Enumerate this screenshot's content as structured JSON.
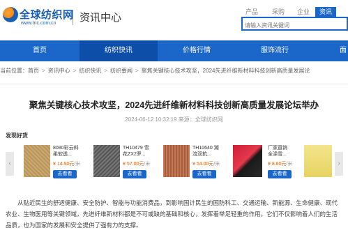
{
  "header": {
    "logo_name": "全球纺织网",
    "logo_url": "www.tnc.com.cn",
    "section_title": "资讯中心"
  },
  "search": {
    "tabs": [
      "产品",
      "采购",
      "企业",
      "资讯"
    ],
    "active_tab": "资讯",
    "placeholder": "请输入资讯关键词"
  },
  "nav": {
    "items": [
      "首页",
      "纺织快讯",
      "价格行情",
      "服饰流行",
      "面"
    ],
    "active": "纺织快讯"
  },
  "breadcrumb": {
    "items": [
      "当前位置：首页",
      "资讯中心",
      "纺织快讯",
      "纺织要闻",
      "聚焦关键核心技术攻坚，2024先进纤维新材料科技创新高质量发展论"
    ]
  },
  "article": {
    "title": "聚焦关键核心技术攻坚，2024先进纤维新材料科技创新高质量发展论坛举办",
    "meta": "2024-06-12 10:32:19 来源：全球纺织网"
  },
  "products": {
    "label": "发现好货",
    "button_label": "去看看",
    "items": [
      {
        "name": "8080彩云斜柔软透...",
        "price": "¥ 14.50元",
        "unit": "/米",
        "image_icon": "fabric-swatch-icon"
      },
      {
        "name": "TH10479 雪花ZX2罗...",
        "price": "¥ 57.00元",
        "unit": "/米",
        "image_icon": "fabric-swatch-icon"
      },
      {
        "name": "TH10640 潮流双抗...",
        "price": "¥ 54.00元",
        "unit": "/米",
        "image_icon": "fabric-swatch-icon"
      },
      {
        "name": "厂家直销 全涤雪...",
        "price": "¥ 8.60元",
        "unit": "/米",
        "image_icon": "fabric-swatch-icon"
      },
      {
        "name": "",
        "price": "",
        "unit": "",
        "image_icon": "fabric-swatch-icon"
      }
    ]
  },
  "body": {
    "paragraph": "从贴近民生的舒适健康、安全防护、智能与功能消费品，到影响国计民生的国防科工、交通运输、新能源、生命健康、现代农业、生物医用等关键领域，先进纤维新材料都是不可或缺的基础和核心，发挥着举足轻重的作用。它们不仅影响着人们的生活品质，也为国家的发展和安全提供了强有力的支撑。"
  },
  "colors": {
    "brand_blue": "#1a66c9",
    "nav_active": "#0d4fa8",
    "price_orange": "#e0600f"
  }
}
